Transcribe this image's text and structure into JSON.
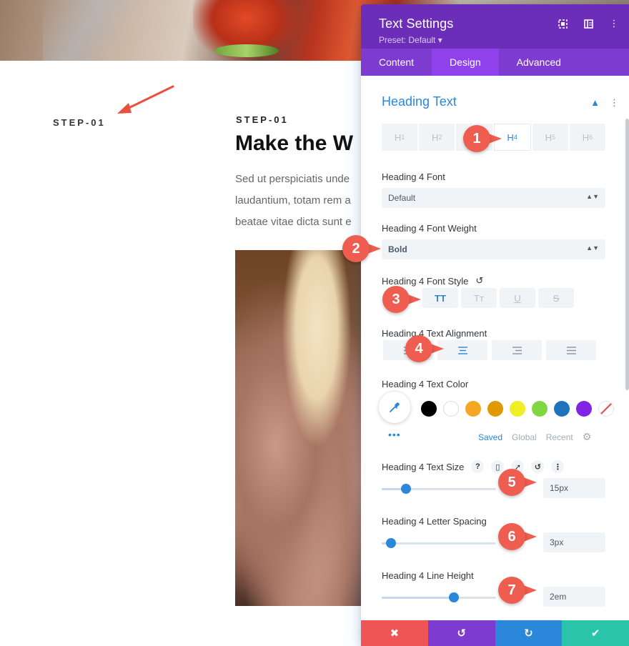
{
  "page": {
    "step_left": "STEP-01",
    "step_right": "STEP-01",
    "heading": "Make the W",
    "paragraph_lines": [
      "Sed ut perspiciatis unde",
      "laudantium, totam rem a",
      "beatae vitae dicta sunt e"
    ]
  },
  "panel": {
    "title": "Text Settings",
    "preset": "Preset: Default",
    "tabs": [
      "Content",
      "Design",
      "Advanced"
    ],
    "active_tab": "Design",
    "section_title": "Heading Text",
    "heading_levels": [
      "1",
      "2",
      "3",
      "4",
      "5",
      "6"
    ],
    "heading_level_prefix": "H",
    "active_level": "4",
    "font": {
      "label": "Heading 4 Font",
      "value": "Default"
    },
    "font_weight": {
      "label": "Heading 4 Font Weight",
      "value": "Bold"
    },
    "font_style": {
      "label": "Heading 4 Font Style",
      "buttons": [
        "TT",
        "Tт",
        "U",
        "S"
      ]
    },
    "alignment": {
      "label": "Heading 4 Text Alignment"
    },
    "text_color": {
      "label": "Heading 4 Text Color",
      "swatches": [
        "#000000",
        "#ffffff",
        "#f5a623",
        "#e09900",
        "#eeee22",
        "#81d742",
        "#1e73be",
        "#8224e3"
      ],
      "palette_tabs": [
        "Saved",
        "Global",
        "Recent"
      ],
      "active_palette_tab": "Saved"
    },
    "text_size": {
      "label": "Heading 4 Text Size",
      "value": "15px",
      "slider_fraction": 0.21
    },
    "letter_spacing": {
      "label": "Heading 4 Letter Spacing",
      "value": "3px",
      "slider_fraction": 0.08
    },
    "line_height": {
      "label": "Heading 4 Line Height",
      "value": "2em",
      "slider_fraction": 0.63
    },
    "footer_colors": [
      "#ef5555",
      "#7e3bd0",
      "#2b87da",
      "#29c4a9"
    ]
  },
  "markers": [
    "1",
    "2",
    "3",
    "4",
    "5",
    "6",
    "7"
  ],
  "colors": {
    "accent": "#2b87da",
    "panel_header": "#6c2eb9",
    "marker": "#ee5d4f"
  }
}
